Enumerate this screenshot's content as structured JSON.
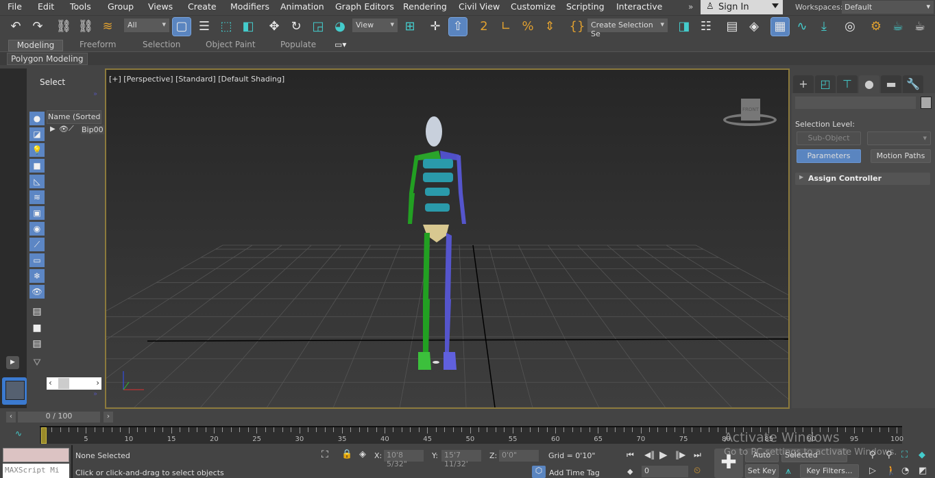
{
  "menu": [
    "File",
    "Edit",
    "Tools",
    "Group",
    "Views",
    "Create",
    "Modifiers",
    "Animation",
    "Graph Editors",
    "Rendering",
    "Civil View",
    "Customize",
    "Scripting",
    "Interactive"
  ],
  "signin": {
    "label": "Sign In"
  },
  "workspaces": {
    "label": "Workspaces:",
    "value": "Default"
  },
  "toolbar": {
    "selection_filter": "All",
    "ref_coord": "View",
    "named_selection": "Create Selection Se"
  },
  "ribbon": {
    "tabs": [
      "Modeling",
      "Freeform",
      "Selection",
      "Object Paint",
      "Populate"
    ],
    "panel": "Polygon Modeling"
  },
  "explorer": {
    "title": "Select",
    "column": "Name (Sorted A",
    "items": [
      {
        "name": "Bip00"
      }
    ]
  },
  "viewport": {
    "label": "[+] [Perspective] [Standard] [Default Shading]",
    "viewcube": "FRONT",
    "accent": "#8c7a3c"
  },
  "command_panel": {
    "selection_level": "Selection Level:",
    "sub_object": "Sub-Object",
    "parameters": "Parameters",
    "motion_paths": "Motion Paths",
    "rollout": "Assign Controller"
  },
  "timeline": {
    "frame": "0 / 100",
    "current": 0,
    "end": 100,
    "labels": [
      "0",
      "5",
      "10",
      "15",
      "20",
      "25",
      "30",
      "35",
      "40",
      "45",
      "50",
      "55",
      "60",
      "65",
      "70",
      "75",
      "80",
      "85",
      "90",
      "95",
      "100"
    ]
  },
  "status": {
    "selected": "None Selected",
    "prompt": "Click or click-and-drag to select objects",
    "maxscript": "MAXScript Mi",
    "x": "10'8 5/32\"",
    "y": "15'7 11/32'",
    "z": "0'0\"",
    "grid": "Grid = 0'10\"",
    "add_time_tag": "Add Time Tag",
    "frame_value": "0",
    "auto_key": "Auto Key",
    "set_key": "Set Key",
    "key_mode": "Selected",
    "key_filters": "Key Filters..."
  },
  "watermark": {
    "line1": "Activate Windows",
    "line2": "Go to PC settings to activate Windows."
  }
}
